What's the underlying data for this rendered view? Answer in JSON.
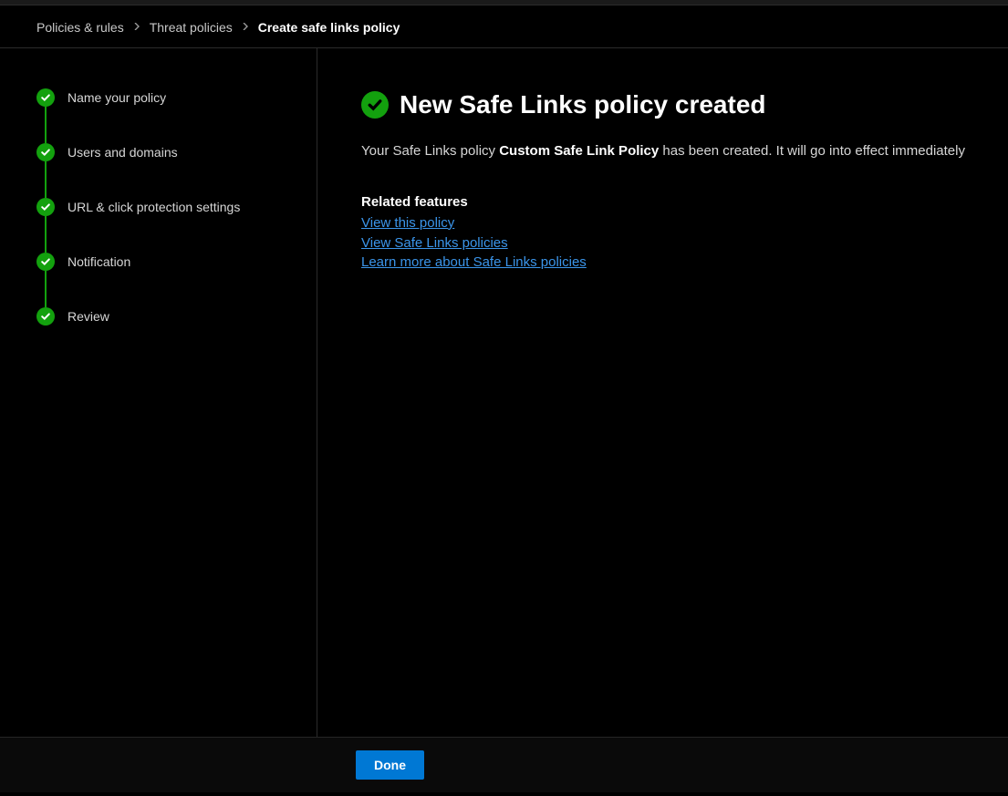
{
  "breadcrumb": {
    "items": [
      {
        "label": "Policies & rules"
      },
      {
        "label": "Threat policies"
      },
      {
        "label": "Create safe links policy"
      }
    ]
  },
  "sidebar": {
    "steps": [
      {
        "label": "Name your policy"
      },
      {
        "label": "Users and domains"
      },
      {
        "label": "URL & click protection settings"
      },
      {
        "label": "Notification"
      },
      {
        "label": "Review"
      }
    ]
  },
  "main": {
    "title": "New Safe Links policy created",
    "description_prefix": "Your Safe Links policy ",
    "policy_name": "Custom Safe Link Policy",
    "description_suffix": " has been created. It will go into effect immediately",
    "related_features_title": "Related features",
    "links": [
      {
        "label": "View this policy"
      },
      {
        "label": "View Safe Links policies"
      },
      {
        "label": "Learn more about Safe Links policies"
      }
    ]
  },
  "footer": {
    "done_label": "Done"
  }
}
